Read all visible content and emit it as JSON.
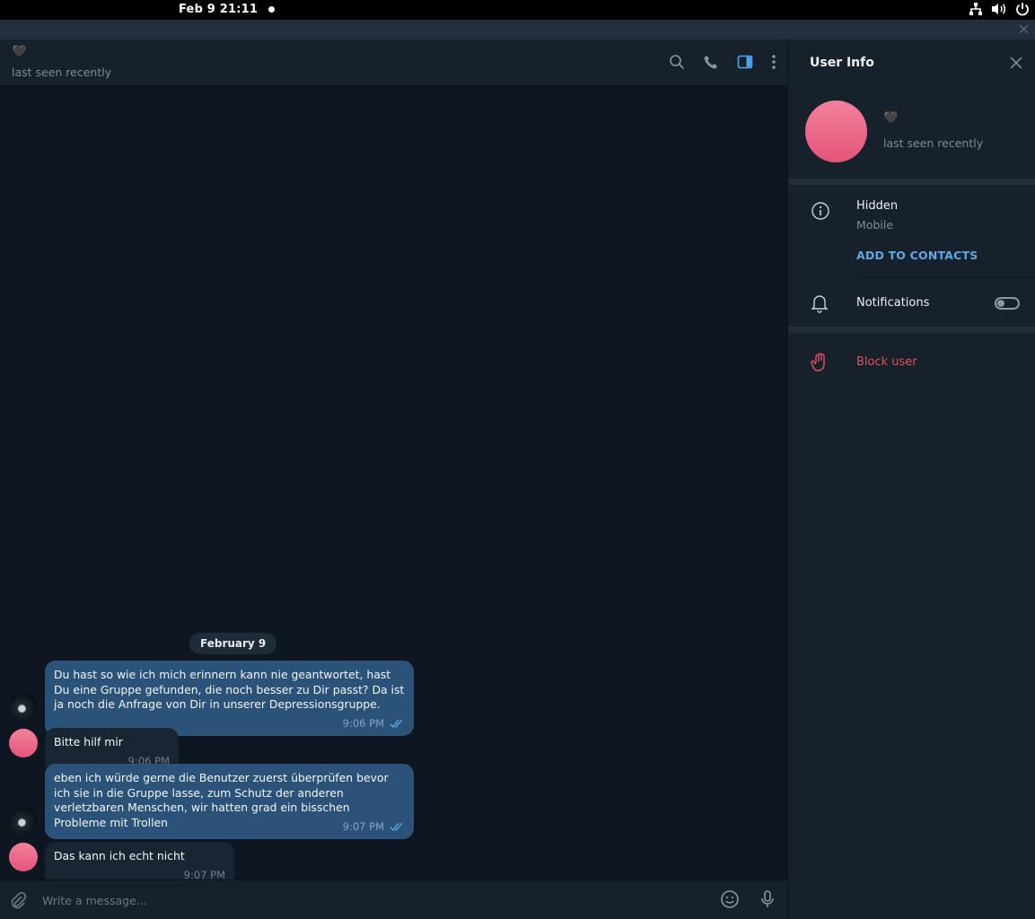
{
  "system_bar": {
    "clock": "Feb 9  21:11"
  },
  "chat": {
    "header": {
      "name": "🖤",
      "status": "last seen recently"
    },
    "date_separator": "February 9",
    "messages": [
      {
        "direction": "out",
        "text": "Du hast so wie ich mich erinnern kann nie geantwortet, hast Du eine Gruppe gefunden, die noch besser zu Dir passt? Da ist ja noch die Anfrage von Dir in unserer Depressionsgruppe.",
        "time": "9:06 PM",
        "read": true
      },
      {
        "direction": "in",
        "text": "Bitte hilf mir",
        "time": "9:06 PM"
      },
      {
        "direction": "out",
        "text": "eben ich würde gerne die Benutzer zuerst überprüfen bevor ich sie in die Gruppe lasse, zum Schutz der anderen verletzbaren Menschen, wir hatten grad ein bisschen Probleme mit Trollen",
        "time": "9:07 PM",
        "read": true
      },
      {
        "direction": "in",
        "text": "Das kann ich echt nicht",
        "time": "9:07 PM"
      }
    ],
    "composer": {
      "placeholder": "Write a message..."
    }
  },
  "user_info": {
    "title": "User Info",
    "name": "🖤",
    "status": "last seen recently",
    "phone_value": "Hidden",
    "phone_label": "Mobile",
    "add_contact": "ADD TO CONTACTS",
    "notifications_label": "Notifications",
    "notifications_enabled": false,
    "block_label": "Block user"
  },
  "colors": {
    "accent": "#5fa8e8",
    "outgoing_bubble": "#2b5278",
    "incoming_bubble": "#182533",
    "danger": "#e0505a",
    "avatar": "#ec6b8b"
  },
  "icons": [
    "network-icon",
    "volume-icon",
    "power-icon",
    "search-icon",
    "phone-icon",
    "sidebar-toggle-icon",
    "more-icon",
    "attach-icon",
    "emoji-icon",
    "mic-icon",
    "info-icon",
    "bell-icon",
    "hand-icon",
    "close-icon"
  ]
}
